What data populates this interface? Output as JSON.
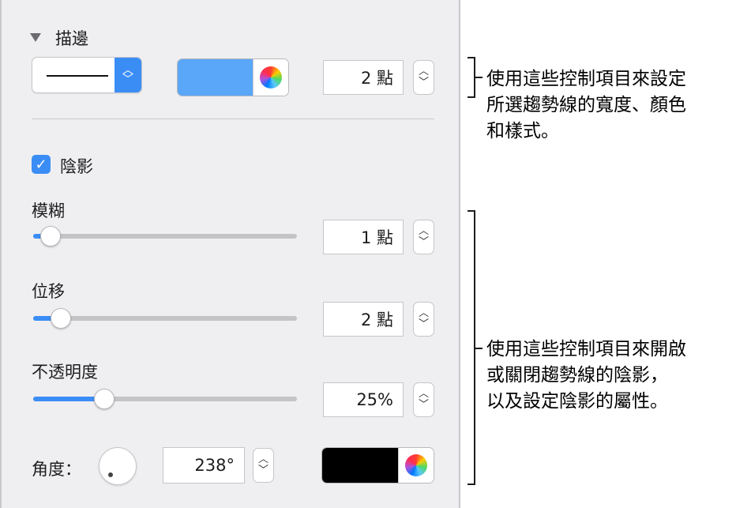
{
  "stroke": {
    "section_title": "描邊",
    "width_value": "2 點",
    "color": "#5aa6f8"
  },
  "shadow": {
    "checkbox_label": "陰影",
    "checked": true,
    "blur": {
      "label": "模糊",
      "value": "1 點",
      "level": 0.03
    },
    "offset": {
      "label": "位移",
      "value": "2 點",
      "level": 0.07
    },
    "opacity": {
      "label": "不透明度",
      "value": "25%",
      "level": 0.25
    },
    "angle": {
      "label": "角度：",
      "value": "238°"
    },
    "color": "#000000"
  },
  "callouts": {
    "stroke_lines": [
      "使用這些控制項目來設定",
      "所選趨勢線的寬度、顏色",
      "和樣式。"
    ],
    "shadow_lines": [
      "使用這些控制項目來開啟",
      "或關閉趨勢線的陰影，",
      "以及設定陰影的屬性。"
    ]
  }
}
